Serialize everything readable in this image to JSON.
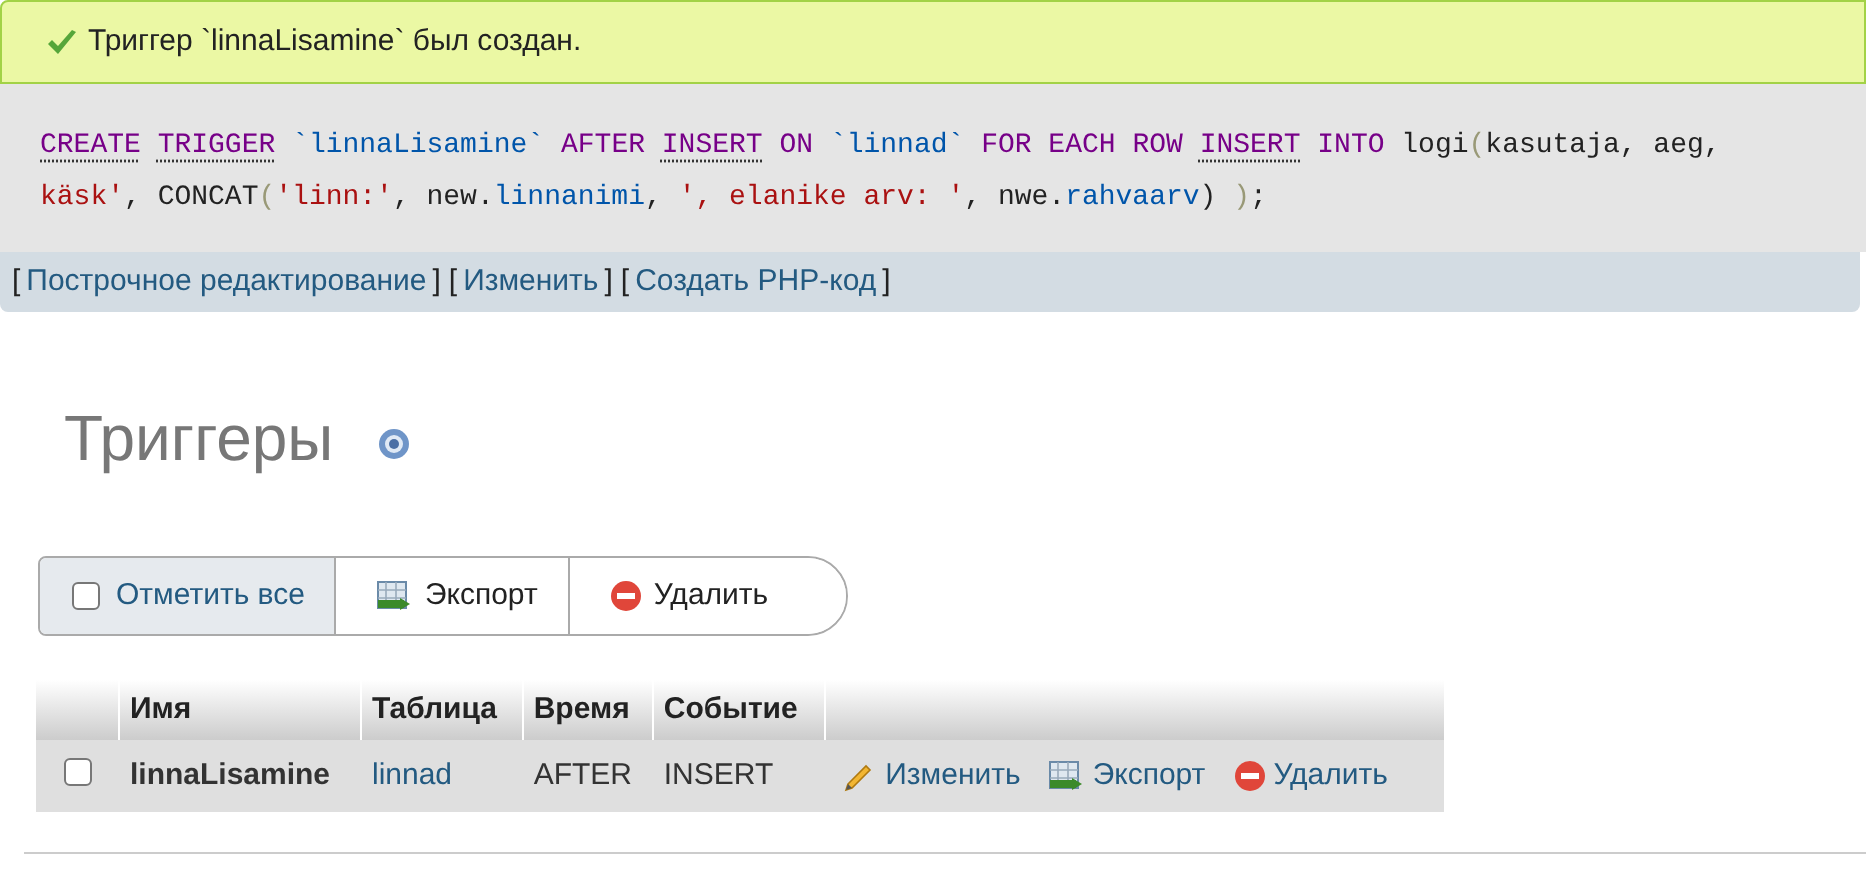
{
  "success_message": "Триггер `linnaLisamine` был создан.",
  "sql_query": {
    "lines": [
      [
        {
          "kind": "link_keyword",
          "text": "CREATE"
        },
        {
          "kind": "link_keyword",
          "text": " TRIGGER"
        },
        {
          "kind": "identifier",
          "text": " `linnaLisamine`"
        },
        {
          "kind": "keyword",
          "text": " AFTER"
        },
        {
          "kind": "link_keyword",
          "text": " INSERT"
        },
        {
          "kind": "keyword",
          "text": " ON"
        },
        {
          "kind": "identifier",
          "text": " `linnad`"
        },
        {
          "kind": "keyword",
          "text": " FOR EACH ROW"
        },
        {
          "kind": "link_keyword",
          "text": " INSERT"
        },
        {
          "kind": "keyword",
          "text": " INTO"
        },
        {
          "kind": "text",
          "text": " logi"
        },
        {
          "kind": "paren",
          "text": "("
        },
        {
          "kind": "text",
          "text": "kasutaja, aeg,"
        }
      ],
      [
        {
          "kind": "string",
          "text": "käsk'"
        },
        {
          "kind": "text",
          "text": ", CONCAT"
        },
        {
          "kind": "paren",
          "text": "("
        },
        {
          "kind": "string",
          "text": "'linn:'"
        },
        {
          "kind": "text",
          "text": ", new."
        },
        {
          "kind": "identifier",
          "text": "linnanimi"
        },
        {
          "kind": "text",
          "text": ", "
        },
        {
          "kind": "string",
          "text": "', elanike arv: '"
        },
        {
          "kind": "text",
          "text": ", nwe."
        },
        {
          "kind": "identifier",
          "text": "rahvaarv"
        },
        {
          "kind": "text",
          "text": ") "
        },
        {
          "kind": "paren",
          "text": ")"
        },
        {
          "kind": "text",
          "text": ";"
        }
      ]
    ]
  },
  "query_links": [
    {
      "open": "[",
      "label": "Построчное редактирование",
      "close": "]"
    },
    {
      "open": "[",
      "label": "Изменить",
      "close": "]"
    },
    {
      "open": "[",
      "label": "Создать PHP-код",
      "close": "]"
    }
  ],
  "heading": "Триггеры",
  "toolbar": {
    "select_all": {
      "label": "Отметить все",
      "checked": false
    },
    "buttons": [
      {
        "kind": "export",
        "label": "Экспорт"
      },
      {
        "kind": "delete",
        "label": "Удалить"
      }
    ]
  },
  "table": {
    "columns": [
      "Имя",
      "Таблица",
      "Время",
      "Событие"
    ],
    "rows": [
      {
        "checked": false,
        "name": "linnaLisamine",
        "table": "linnad",
        "time": "AFTER",
        "event": "INSERT",
        "actions": [
          {
            "kind": "edit",
            "label": "Изменить"
          },
          {
            "kind": "export",
            "label": "Экспорт"
          },
          {
            "kind": "delete",
            "label": "Удалить"
          }
        ]
      }
    ]
  }
}
